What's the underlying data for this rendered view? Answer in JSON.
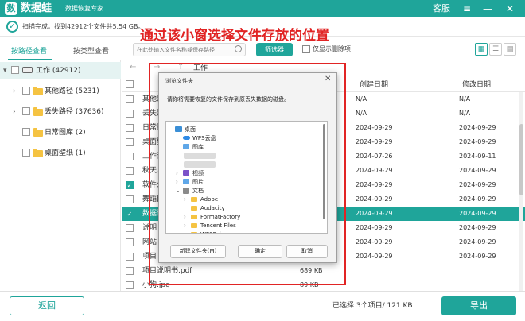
{
  "app": {
    "logo_char": "数",
    "name": "数据蛙",
    "subtitle": "数据恢复专家",
    "support": "客服"
  },
  "window_controls": {
    "menu": "≡",
    "minimize": "—",
    "close": "✕"
  },
  "scan": {
    "message": "扫描完成。找到42912个文件共5.54 GB。"
  },
  "annotation": "通过该小窗选择文件存放的位置",
  "tabs": {
    "by_path": "按路径查看",
    "by_type": "按类型查看"
  },
  "toolbar": {
    "search_placeholder": "在此处输入文件名称或保存路径",
    "filter_label": "筛选器",
    "show_deleted_label": "仅显示删除项"
  },
  "tree": {
    "root_label": "工作 (42912)",
    "items": [
      {
        "label": "其他路径 (5231)"
      },
      {
        "label": "丢失路径 (37636)"
      },
      {
        "label": "日常图库 (2)"
      },
      {
        "label": "桌面壁纸 (1)"
      }
    ]
  },
  "filelist": {
    "path_label": "工作",
    "headers": {
      "created": "创建日期",
      "modified": "修改日期"
    },
    "rows": [
      {
        "name": "其他路",
        "created": "N/A",
        "modified": "N/A",
        "checked": false
      },
      {
        "name": "丢失路",
        "created": "N/A",
        "modified": "N/A",
        "checked": false
      },
      {
        "name": "日常图",
        "created": "2024-09-29",
        "modified": "2024-09-29",
        "checked": false
      },
      {
        "name": "桌面壁",
        "created": "2024-09-29",
        "modified": "2024-09-29",
        "checked": false
      },
      {
        "name": "工作计",
        "created": "2024-07-26",
        "modified": "2024-09-11",
        "checked": false
      },
      {
        "name": "秋天.",
        "created": "2024-09-29",
        "modified": "2024-09-29",
        "checked": false
      },
      {
        "name": "软件介",
        "created": "2024-09-29",
        "modified": "2024-09-29",
        "checked": true
      },
      {
        "name": "舞蹈比",
        "created": "2024-09-29",
        "modified": "2024-09-29",
        "checked": false
      },
      {
        "name": "数据说",
        "created": "2024-09-29",
        "modified": "2024-09-29",
        "checked": true,
        "selected": true
      },
      {
        "name": "说明",
        "created": "2024-09-29",
        "modified": "2024-09-29",
        "checked": false
      },
      {
        "name": "网站",
        "created": "2024-09-29",
        "modified": "2024-09-29",
        "checked": false
      },
      {
        "name": "项目",
        "created": "2024-09-29",
        "modified": "2024-09-29",
        "checked": false
      },
      {
        "name": "项目说明书.pdf",
        "size": "689 KB",
        "checked": false
      },
      {
        "name": "小狗.jpg",
        "size": "89 KB",
        "checked": false
      }
    ]
  },
  "dialog": {
    "title": "浏览文件夹",
    "message": "请你将需要恢复的文件保存到原丢失数据的磁盘。",
    "tree": [
      {
        "label": "桌面",
        "icon": "desktop",
        "level": 0
      },
      {
        "label": "WPS云盘",
        "icon": "cloud",
        "level": 1
      },
      {
        "label": "图库",
        "icon": "picture",
        "level": 1
      },
      {
        "label": "",
        "icon": "blurred",
        "level": 1
      },
      {
        "label": "",
        "icon": "blurred",
        "level": 1
      },
      {
        "label": "视频",
        "icon": "video",
        "level": 1,
        "expandable": true
      },
      {
        "label": "图片",
        "icon": "picture",
        "level": 1,
        "expandable": true
      },
      {
        "label": "文档",
        "icon": "document",
        "level": 1,
        "expanded": true
      },
      {
        "label": "Adobe",
        "icon": "folder",
        "level": 2,
        "expandable": true
      },
      {
        "label": "Audacity",
        "icon": "folder",
        "level": 2
      },
      {
        "label": "FormatFactory",
        "icon": "folder",
        "level": 2,
        "expandable": true
      },
      {
        "label": "Tencent Files",
        "icon": "folder",
        "level": 2,
        "expandable": true
      },
      {
        "label": "WPSDrive",
        "icon": "folder",
        "level": 2,
        "expandable": true
      }
    ],
    "buttons": {
      "new_folder": "新建文件夹(M)",
      "ok": "确定",
      "cancel": "取消"
    },
    "close": "✕"
  },
  "bottom": {
    "back": "返回",
    "selection_info": "已选择 3个项目/ 121 KB",
    "export": "导出"
  },
  "colors": {
    "brand": "#1fa59a",
    "annotation": "#e12424"
  }
}
